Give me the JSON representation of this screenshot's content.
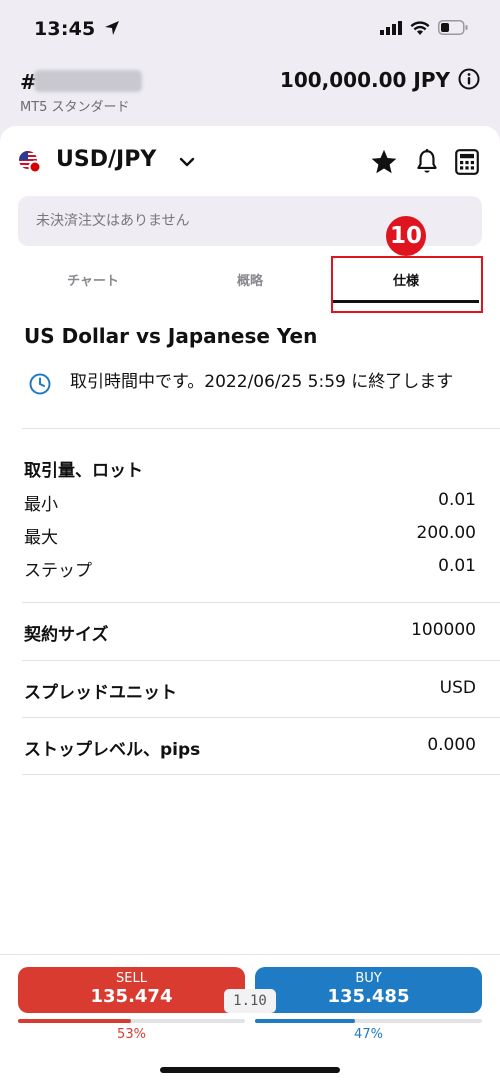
{
  "status": {
    "time": "13:45"
  },
  "account": {
    "hash": "#",
    "type": "MT5 スタンダード",
    "balance": "100,000.00 JPY"
  },
  "symbol": {
    "name": "USD/JPY"
  },
  "orders": {
    "empty_text": "未決済注文はありません"
  },
  "tabs": [
    {
      "label": "チャート"
    },
    {
      "label": "概略"
    },
    {
      "label": "仕様"
    }
  ],
  "annotation": {
    "badge": "10"
  },
  "spec": {
    "title": "US Dollar vs Japanese Yen",
    "session": "取引時間中です。2022/06/25 5:59 に終了します",
    "volume": {
      "heading": "取引量、ロット",
      "min_label": "最小",
      "min_value": "0.01",
      "max_label": "最大",
      "max_value": "200.00",
      "step_label": "ステップ",
      "step_value": "0.01"
    },
    "contract": {
      "label": "契約サイズ",
      "value": "100000"
    },
    "spread_unit": {
      "label": "スプレッドユニット",
      "value": "USD"
    },
    "stop_level": {
      "label": "ストップレベル、pips",
      "value": "0.000"
    }
  },
  "trade": {
    "sell_label": "SELL",
    "sell_price": "135.474",
    "buy_label": "BUY",
    "buy_price": "135.485",
    "spread": "1.10",
    "sell_pct": "53%",
    "buy_pct": "47%",
    "sell_ratio": 0.53,
    "buy_ratio": 0.47
  },
  "colors": {
    "sell": "#d93b30",
    "buy": "#1f7bc4",
    "annotation": "#e0141e"
  },
  "icons": [
    "location-arrow-icon",
    "signal-icon",
    "wifi-icon",
    "battery-icon",
    "info-icon",
    "us-flag-icon",
    "chevron-down-icon",
    "star-icon",
    "bell-icon",
    "calculator-icon",
    "clock-icon"
  ]
}
